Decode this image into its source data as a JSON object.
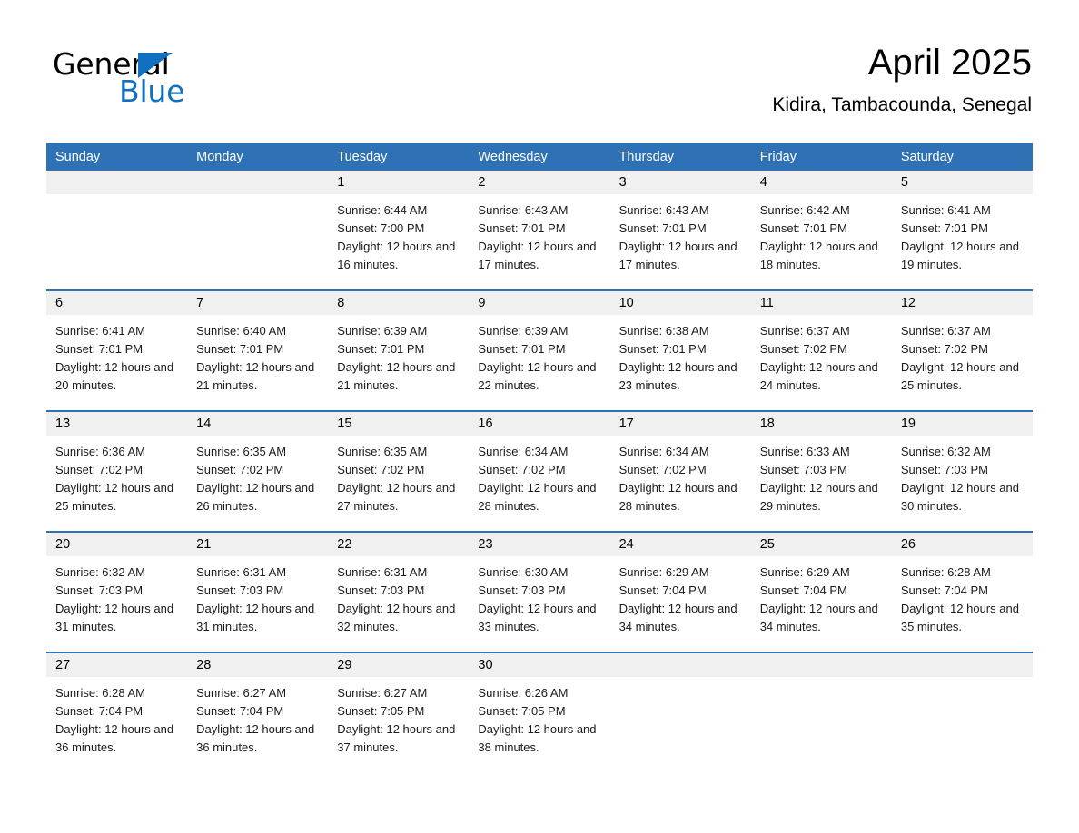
{
  "brand": {
    "name_part1": "General",
    "name_part2": "Blue",
    "triangle_icon": "triangle-logo-icon",
    "accent_color": "#1270c0"
  },
  "header": {
    "month_title": "April 2025",
    "location": "Kidira, Tambacounda, Senegal"
  },
  "theme": {
    "header_blue": "#2e72b5",
    "day_band_gray": "#f0f0f0",
    "cell_white": "#ffffff"
  },
  "weekdays": [
    "Sunday",
    "Monday",
    "Tuesday",
    "Wednesday",
    "Thursday",
    "Friday",
    "Saturday"
  ],
  "weeks": [
    [
      {
        "day": "",
        "sunrise": "",
        "sunset": "",
        "daylight": "",
        "empty": true
      },
      {
        "day": "",
        "sunrise": "",
        "sunset": "",
        "daylight": "",
        "empty": true
      },
      {
        "day": "1",
        "sunrise": "Sunrise: 6:44 AM",
        "sunset": "Sunset: 7:00 PM",
        "daylight": "Daylight: 12 hours and 16 minutes."
      },
      {
        "day": "2",
        "sunrise": "Sunrise: 6:43 AM",
        "sunset": "Sunset: 7:01 PM",
        "daylight": "Daylight: 12 hours and 17 minutes."
      },
      {
        "day": "3",
        "sunrise": "Sunrise: 6:43 AM",
        "sunset": "Sunset: 7:01 PM",
        "daylight": "Daylight: 12 hours and 17 minutes."
      },
      {
        "day": "4",
        "sunrise": "Sunrise: 6:42 AM",
        "sunset": "Sunset: 7:01 PM",
        "daylight": "Daylight: 12 hours and 18 minutes."
      },
      {
        "day": "5",
        "sunrise": "Sunrise: 6:41 AM",
        "sunset": "Sunset: 7:01 PM",
        "daylight": "Daylight: 12 hours and 19 minutes."
      }
    ],
    [
      {
        "day": "6",
        "sunrise": "Sunrise: 6:41 AM",
        "sunset": "Sunset: 7:01 PM",
        "daylight": "Daylight: 12 hours and 20 minutes."
      },
      {
        "day": "7",
        "sunrise": "Sunrise: 6:40 AM",
        "sunset": "Sunset: 7:01 PM",
        "daylight": "Daylight: 12 hours and 21 minutes."
      },
      {
        "day": "8",
        "sunrise": "Sunrise: 6:39 AM",
        "sunset": "Sunset: 7:01 PM",
        "daylight": "Daylight: 12 hours and 21 minutes."
      },
      {
        "day": "9",
        "sunrise": "Sunrise: 6:39 AM",
        "sunset": "Sunset: 7:01 PM",
        "daylight": "Daylight: 12 hours and 22 minutes."
      },
      {
        "day": "10",
        "sunrise": "Sunrise: 6:38 AM",
        "sunset": "Sunset: 7:01 PM",
        "daylight": "Daylight: 12 hours and 23 minutes."
      },
      {
        "day": "11",
        "sunrise": "Sunrise: 6:37 AM",
        "sunset": "Sunset: 7:02 PM",
        "daylight": "Daylight: 12 hours and 24 minutes."
      },
      {
        "day": "12",
        "sunrise": "Sunrise: 6:37 AM",
        "sunset": "Sunset: 7:02 PM",
        "daylight": "Daylight: 12 hours and 25 minutes."
      }
    ],
    [
      {
        "day": "13",
        "sunrise": "Sunrise: 6:36 AM",
        "sunset": "Sunset: 7:02 PM",
        "daylight": "Daylight: 12 hours and 25 minutes."
      },
      {
        "day": "14",
        "sunrise": "Sunrise: 6:35 AM",
        "sunset": "Sunset: 7:02 PM",
        "daylight": "Daylight: 12 hours and 26 minutes."
      },
      {
        "day": "15",
        "sunrise": "Sunrise: 6:35 AM",
        "sunset": "Sunset: 7:02 PM",
        "daylight": "Daylight: 12 hours and 27 minutes."
      },
      {
        "day": "16",
        "sunrise": "Sunrise: 6:34 AM",
        "sunset": "Sunset: 7:02 PM",
        "daylight": "Daylight: 12 hours and 28 minutes."
      },
      {
        "day": "17",
        "sunrise": "Sunrise: 6:34 AM",
        "sunset": "Sunset: 7:02 PM",
        "daylight": "Daylight: 12 hours and 28 minutes."
      },
      {
        "day": "18",
        "sunrise": "Sunrise: 6:33 AM",
        "sunset": "Sunset: 7:03 PM",
        "daylight": "Daylight: 12 hours and 29 minutes."
      },
      {
        "day": "19",
        "sunrise": "Sunrise: 6:32 AM",
        "sunset": "Sunset: 7:03 PM",
        "daylight": "Daylight: 12 hours and 30 minutes."
      }
    ],
    [
      {
        "day": "20",
        "sunrise": "Sunrise: 6:32 AM",
        "sunset": "Sunset: 7:03 PM",
        "daylight": "Daylight: 12 hours and 31 minutes."
      },
      {
        "day": "21",
        "sunrise": "Sunrise: 6:31 AM",
        "sunset": "Sunset: 7:03 PM",
        "daylight": "Daylight: 12 hours and 31 minutes."
      },
      {
        "day": "22",
        "sunrise": "Sunrise: 6:31 AM",
        "sunset": "Sunset: 7:03 PM",
        "daylight": "Daylight: 12 hours and 32 minutes."
      },
      {
        "day": "23",
        "sunrise": "Sunrise: 6:30 AM",
        "sunset": "Sunset: 7:03 PM",
        "daylight": "Daylight: 12 hours and 33 minutes."
      },
      {
        "day": "24",
        "sunrise": "Sunrise: 6:29 AM",
        "sunset": "Sunset: 7:04 PM",
        "daylight": "Daylight: 12 hours and 34 minutes."
      },
      {
        "day": "25",
        "sunrise": "Sunrise: 6:29 AM",
        "sunset": "Sunset: 7:04 PM",
        "daylight": "Daylight: 12 hours and 34 minutes."
      },
      {
        "day": "26",
        "sunrise": "Sunrise: 6:28 AM",
        "sunset": "Sunset: 7:04 PM",
        "daylight": "Daylight: 12 hours and 35 minutes."
      }
    ],
    [
      {
        "day": "27",
        "sunrise": "Sunrise: 6:28 AM",
        "sunset": "Sunset: 7:04 PM",
        "daylight": "Daylight: 12 hours and 36 minutes."
      },
      {
        "day": "28",
        "sunrise": "Sunrise: 6:27 AM",
        "sunset": "Sunset: 7:04 PM",
        "daylight": "Daylight: 12 hours and 36 minutes."
      },
      {
        "day": "29",
        "sunrise": "Sunrise: 6:27 AM",
        "sunset": "Sunset: 7:05 PM",
        "daylight": "Daylight: 12 hours and 37 minutes."
      },
      {
        "day": "30",
        "sunrise": "Sunrise: 6:26 AM",
        "sunset": "Sunset: 7:05 PM",
        "daylight": "Daylight: 12 hours and 38 minutes."
      },
      {
        "day": "",
        "sunrise": "",
        "sunset": "",
        "daylight": "",
        "empty": true
      },
      {
        "day": "",
        "sunrise": "",
        "sunset": "",
        "daylight": "",
        "empty": true
      },
      {
        "day": "",
        "sunrise": "",
        "sunset": "",
        "daylight": "",
        "empty": true
      }
    ]
  ]
}
